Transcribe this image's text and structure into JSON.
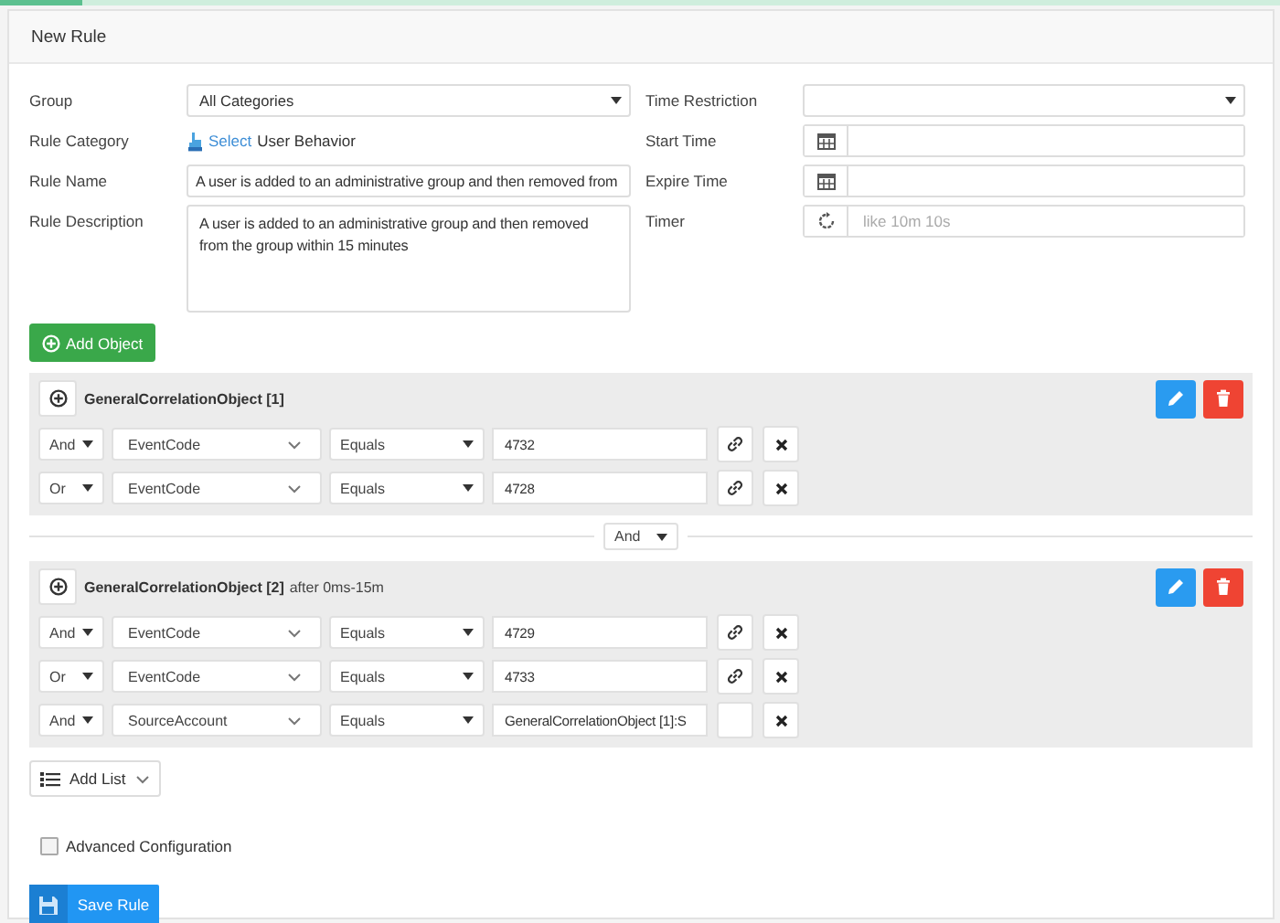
{
  "title": "New Rule",
  "form_left": [
    {
      "kind": "select",
      "label": "Group",
      "value": "All Categories"
    },
    {
      "kind": "link",
      "label": "Rule Category",
      "link": "Select",
      "value": "User Behavior"
    },
    {
      "kind": "text",
      "label": "Rule Name",
      "value": "A user is added to an administrative group and then removed from"
    },
    {
      "kind": "textarea",
      "label": "Rule Description",
      "value": "A user is added to an administrative group and then removed from the group within 15 minutes"
    }
  ],
  "form_right": [
    {
      "kind": "select",
      "label": "Time Restriction"
    },
    {
      "kind": "date",
      "label": "Start Time"
    },
    {
      "kind": "date",
      "label": "Expire Time"
    },
    {
      "kind": "timer",
      "label": "Timer",
      "placeholder": "like 10m 10s"
    }
  ],
  "add_object_button": "Add Object",
  "objects": [
    {
      "name": "GeneralCorrelationObject [1]",
      "conditions": [
        {
          "join": "And",
          "field": "EventCode",
          "operator": "Equals",
          "value": "4732",
          "linked": true
        },
        {
          "join": "Or",
          "field": "EventCode",
          "operator": "Equals",
          "value": "4728",
          "linked": true
        }
      ]
    },
    {
      "name": "GeneralCorrelationObject [2]",
      "note": "after 0ms-15m",
      "conditions": [
        {
          "join": "And",
          "field": "EventCode",
          "operator": "Equals",
          "value": "4729",
          "linked": true
        },
        {
          "join": "Or",
          "field": "EventCode",
          "operator": "Equals",
          "value": "4733",
          "linked": true
        },
        {
          "join": "And",
          "field": "SourceAccount",
          "operator": "Equals",
          "value": "GeneralCorrelationObject [1]:S",
          "linked": false
        }
      ]
    }
  ],
  "object_join": "And",
  "add_list_button": "Add List",
  "advanced": {
    "label": "Advanced Configuration",
    "checked": false
  },
  "save_button": "Save Rule"
}
